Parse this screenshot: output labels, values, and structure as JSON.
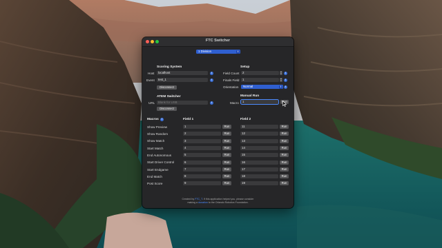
{
  "window": {
    "title": "FTC Switcher"
  },
  "division": {
    "selected": "1 Division"
  },
  "scoring": {
    "header": "Scoring System",
    "host_label": "Host",
    "host_value": "localhost",
    "event_label": "Event",
    "event_value": "test_1",
    "disconnect_label": "Disconnect"
  },
  "setup": {
    "header": "Setup",
    "field_count_label": "Field Count",
    "field_count_value": "2",
    "finals_field_label": "Finals Field",
    "finals_field_value": "1",
    "orientation_label": "Orientation",
    "orientation_value": "Normal"
  },
  "atem": {
    "header": "ATEM Switcher",
    "url_label": "URL",
    "url_placeholder": "Blank for USB",
    "disconnect_label": "Disconnect"
  },
  "manual": {
    "header": "Manual Run",
    "macro_label": "Macro",
    "macro_value": "1",
    "run_label": "Run"
  },
  "macros": {
    "header": "Macros",
    "field1_header": "Field 1",
    "field2_header": "Field 2",
    "run_label": "Run",
    "rows": [
      {
        "name": "Show Preview",
        "f1": "1",
        "f2": "11"
      },
      {
        "name": "Show Random",
        "f1": "2",
        "f2": "12"
      },
      {
        "name": "Show Match",
        "f1": "3",
        "f2": "13"
      },
      {
        "name": "Start Match",
        "f1": "4",
        "f2": "14"
      },
      {
        "name": "End Autonomous",
        "f1": "5",
        "f2": "15"
      },
      {
        "name": "Start Driver Control",
        "f1": "6",
        "f2": "16"
      },
      {
        "name": "Start Endgame",
        "f1": "7",
        "f2": "17"
      },
      {
        "name": "End Match",
        "f1": "8",
        "f2": "18"
      },
      {
        "name": "Post Score",
        "f1": "9",
        "f2": "19"
      }
    ]
  },
  "footer": {
    "line1_a": "Created by ",
    "line1_link": "FTC_T",
    "line1_b": ". If this application helped you, please consider",
    "line2_a": "making a ",
    "line2_link": "donation",
    "line2_b": " to the Orlando Robotics Foundation."
  },
  "icons": {
    "info": "info-icon",
    "stepper": "stepper-icon",
    "chevron": "chevron-updown-icon"
  },
  "colors": {
    "accent": "#2f5fd0",
    "window_bg": "#262628",
    "field_bg": "#3a3a3c"
  }
}
